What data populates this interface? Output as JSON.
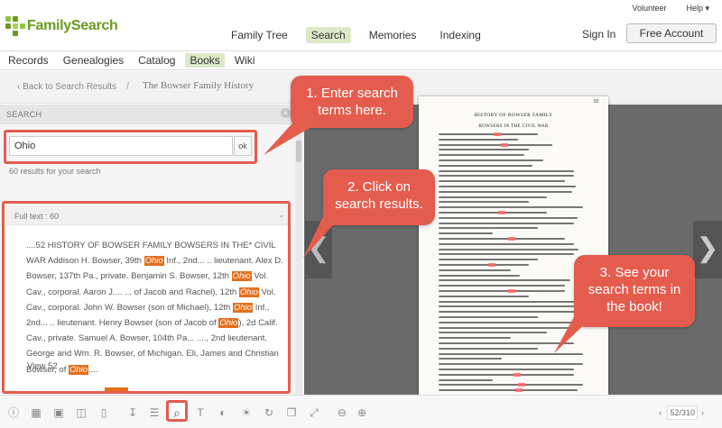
{
  "header": {
    "logo_text": "FamilySearch",
    "top_links": [
      "Volunteer",
      "Help ▾"
    ],
    "nav": [
      {
        "label": "Family Tree",
        "active": false
      },
      {
        "label": "Search",
        "active": true
      },
      {
        "label": "Memories",
        "active": false
      },
      {
        "label": "Indexing",
        "active": false
      }
    ],
    "sign_in": "Sign In",
    "free_account": "Free Account"
  },
  "subnav": [
    {
      "label": "Records",
      "active": false
    },
    {
      "label": "Genealogies",
      "active": false
    },
    {
      "label": "Catalog",
      "active": false
    },
    {
      "label": "Books",
      "active": true
    },
    {
      "label": "Wiki",
      "active": false
    }
  ],
  "breadcrumb": {
    "back": "‹ Back to Search Results",
    "separator": "/",
    "title": "The Bowser Family History"
  },
  "search_panel": {
    "title": "SEARCH",
    "close_glyph": "×",
    "input_value": "Ohio",
    "ok_label": "ok",
    "result_count": "60 results for your search",
    "fulltext_label": "Full text : 60",
    "chevron": "⌄",
    "snippet": [
      {
        "text": "....52 HISTORY OF BOWSER FAMILY BOWSERS IN THE* CIVIL WAR Addison H. Bowser, 39th ",
        "hl": false
      },
      {
        "text": "Ohio",
        "hl": true
      },
      {
        "text": " Inf., 2nd... .. lieutenant. Alex D. Bowser, 137th Pa., private. Benjamin S. Bowser, 12th ",
        "hl": false
      },
      {
        "text": "Ohio",
        "hl": true
      },
      {
        "text": " Vol. Cav., corporal. Aaron J.... ... of Jacob and Rachel), 12th ",
        "hl": false
      },
      {
        "text": "Ohio",
        "hl": true
      },
      {
        "text": " Vol. Cav., corporal. John W. Bowser (son of Michael), 12th ",
        "hl": false
      },
      {
        "text": "Ohio",
        "hl": true
      },
      {
        "text": " Inf., 2nd... .. lieutenant. Henry Bowser (son of Jacob of ",
        "hl": false
      },
      {
        "text": "Ohio",
        "hl": true
      },
      {
        "text": "), 2d Calif. Cav., private. Samuel A. Bowser, 104th Pa... ...., 2nd lieutenant. George and Wm. R. Bowser, of Michigan. Eli, James and Christian Bowser, of ",
        "hl": false
      },
      {
        "text": "Ohio",
        "hl": true
      },
      {
        "text": "....",
        "hl": false
      }
    ],
    "view_link": "View 52"
  },
  "book_page": {
    "page_number": "52",
    "heading": "HISTORY OF BOWSER FAMILY",
    "subheading": "BOWSERS IN THE CIVIL WAR"
  },
  "callouts": [
    "1. Enter search terms here.",
    "2. Click on search results.",
    "3. See your search terms in the book!"
  ],
  "viewer": {
    "prev_glyph": "❮",
    "next_glyph": "❯"
  },
  "toolbar": {
    "icons": [
      "info-icon",
      "grid-icon",
      "thumbnails-icon",
      "two-page-icon",
      "single-page-icon",
      "download-icon",
      "list-icon",
      "search-icon",
      "text-icon",
      "contrast-icon",
      "brightness-icon",
      "rotate-icon",
      "copy-icon",
      "fullscreen-icon",
      "zoom-out-icon",
      "zoom-in-icon"
    ],
    "pager_prev": "‹",
    "pager_next": "›",
    "pager_value": "52/310"
  },
  "colors": {
    "brand_green": "#6a9a1f",
    "active_tab": "#dde8c8",
    "highlight_orange": "#e3701c",
    "callout_red": "#e45c4e"
  }
}
